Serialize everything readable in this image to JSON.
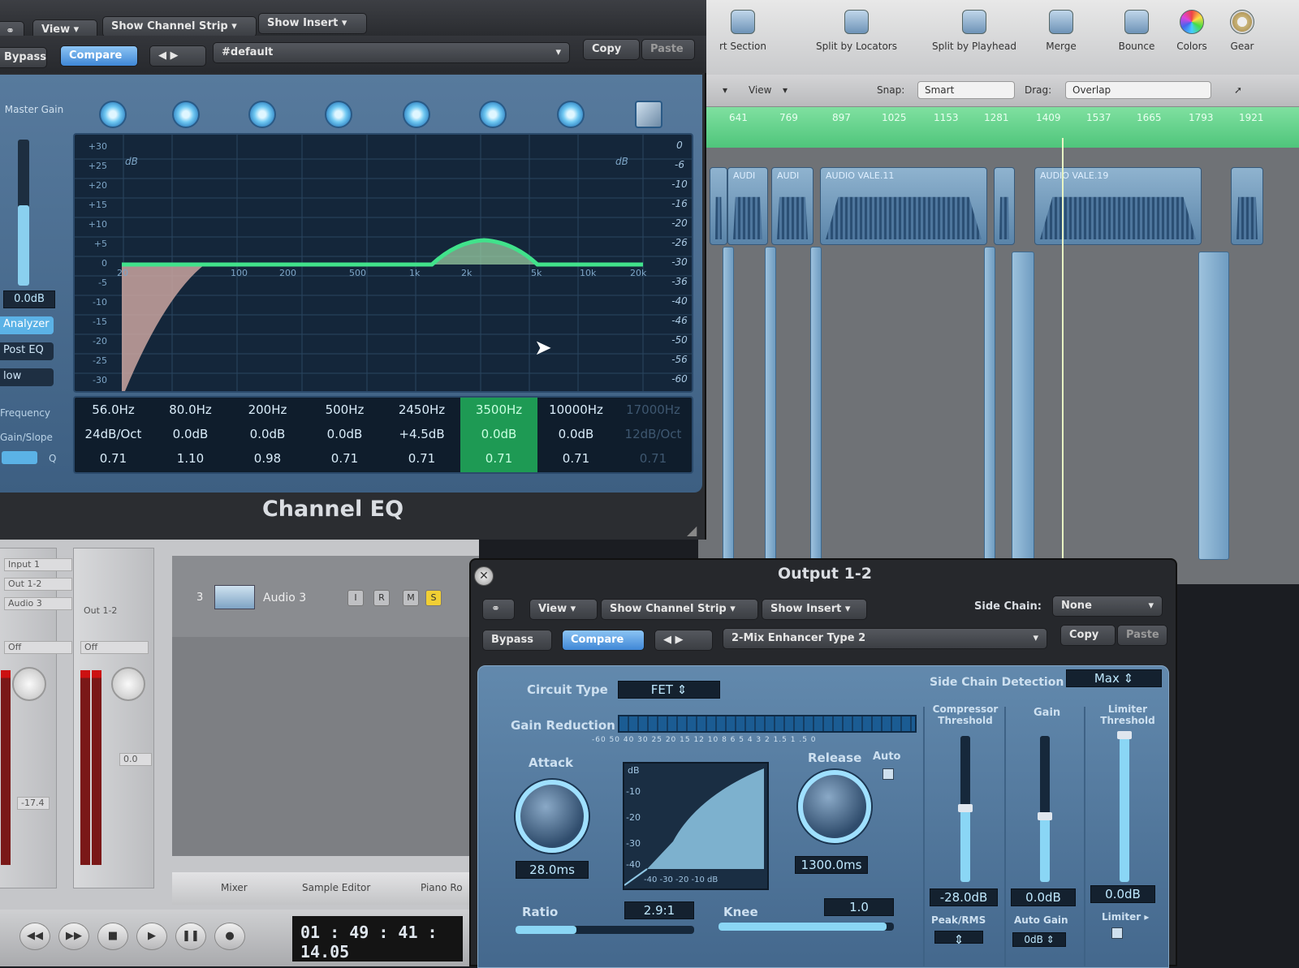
{
  "arrange": {
    "toolbar": {
      "items": [
        "rt Section",
        "Split by Locators",
        "Split by Playhead",
        "Merge",
        "Bounce",
        "Colors",
        "Gear"
      ]
    },
    "subbar": {
      "view_label": "View",
      "snap_label": "Snap:",
      "snap_value": "Smart",
      "drag_label": "Drag:",
      "drag_value": "Overlap"
    },
    "ruler_marks": [
      "641",
      "769",
      "897",
      "1025",
      "1153",
      "1281",
      "1409",
      "1537",
      "1665",
      "1793",
      "1921"
    ],
    "regions": [
      "AUDI",
      "AUDI",
      "AUDIO VALE.11",
      "AUDIO VALE.19"
    ]
  },
  "channel_eq": {
    "title": "Channel EQ",
    "header": {
      "view": "View",
      "show_channel_strip": "Show Channel Strip",
      "show_insert": "Show Insert",
      "bypass": "Bypass",
      "compare": "Compare",
      "preset": "#default",
      "copy": "Copy",
      "paste": "Paste"
    },
    "master_gain": {
      "label": "Master Gain",
      "value": "0.0dB",
      "level": 0.55
    },
    "side_popups": [
      "Analyzer",
      "Post EQ",
      "low"
    ],
    "graph": {
      "db_tag_left": "dB",
      "db_tag_right": "dB",
      "left_scale": [
        "+30",
        "+25",
        "+20",
        "+15",
        "+10",
        "+5",
        "0",
        "-5",
        "-10",
        "-15",
        "-20",
        "-25",
        "-30"
      ],
      "right_scale": [
        "0",
        "-6",
        "-10",
        "-16",
        "-20",
        "-26",
        "-30",
        "-36",
        "-40",
        "-46",
        "-50",
        "-56",
        "-60"
      ],
      "freq_labels": [
        "20",
        "100",
        "200",
        "500",
        "1k",
        "2k",
        "5k",
        "10k",
        "20k"
      ]
    },
    "param_labels": [
      "Frequency",
      "Gain/Slope",
      "Q"
    ],
    "bands": [
      {
        "freq": "56.0Hz",
        "gain": "24dB/Oct",
        "q": "0.71"
      },
      {
        "freq": "80.0Hz",
        "gain": "0.0dB",
        "q": "1.10"
      },
      {
        "freq": "200Hz",
        "gain": "0.0dB",
        "q": "0.98"
      },
      {
        "freq": "500Hz",
        "gain": "0.0dB",
        "q": "0.71"
      },
      {
        "freq": "2450Hz",
        "gain": "+4.5dB",
        "q": "0.71"
      },
      {
        "freq": "3500Hz",
        "gain": "0.0dB",
        "q": "0.71"
      },
      {
        "freq": "10000Hz",
        "gain": "0.0dB",
        "q": "0.71"
      },
      {
        "freq": "17000Hz",
        "gain": "12dB/Oct",
        "q": "0.71"
      }
    ],
    "selected_band": 5
  },
  "mixer": {
    "strip_labels": [
      "Input 1",
      "Out 1-2",
      "Audio 3"
    ],
    "strip2_label": "Out 1-2",
    "off_labels": [
      "Off",
      "Off"
    ],
    "fader_values": [
      "-17.4",
      "0.0"
    ],
    "track": {
      "number": "3",
      "name": "Audio 3",
      "buttons": [
        "I",
        "R",
        "M",
        "S"
      ]
    },
    "tabs": [
      "Mixer",
      "Sample Editor",
      "Piano Ro"
    ],
    "transport_time": "01 : 49 : 41 : 14.05"
  },
  "compressor": {
    "title": "Output 1-2",
    "header": {
      "view": "View",
      "show_channel_strip": "Show Channel Strip",
      "show_insert": "Show Insert",
      "side_chain_label": "Side Chain:",
      "side_chain_value": "None",
      "bypass": "Bypass",
      "compare": "Compare",
      "preset": "2-Mix Enhancer Type 2",
      "copy": "Copy",
      "paste": "Paste"
    },
    "circuit_type_label": "Circuit Type",
    "circuit_type_value": "FET",
    "side_chain_detection_label": "Side Chain Detection",
    "side_chain_detection_value": "Max",
    "gain_reduction_label": "Gain Reduction",
    "gr_scale": "-60 50 40 30 25 20 15 12 10 8 6 5 4 3 2 1.5 1 .5 0",
    "attack_label": "Attack",
    "attack_value": "28.0ms",
    "release_label": "Release",
    "release_value": "1300.0ms",
    "auto_label": "Auto",
    "curve_db": "dB",
    "curve_y": [
      "-10",
      "-20",
      "-30",
      "-40"
    ],
    "curve_x": "-40 -30 -20 -10 dB",
    "ratio_label": "Ratio",
    "ratio_value": "2.9:1",
    "knee_label": "Knee",
    "knee_value": "1.0",
    "threshold_label": "Compressor Threshold",
    "threshold_value": "-28.0dB",
    "gain_label": "Gain",
    "gain_value": "0.0dB",
    "limiter_label": "Limiter Threshold",
    "limiter_value": "0.0dB",
    "peak_rms": "Peak/RMS",
    "auto_gain": "Auto Gain",
    "auto_gain_value": "0dB",
    "limiter_toggle": "Limiter"
  }
}
